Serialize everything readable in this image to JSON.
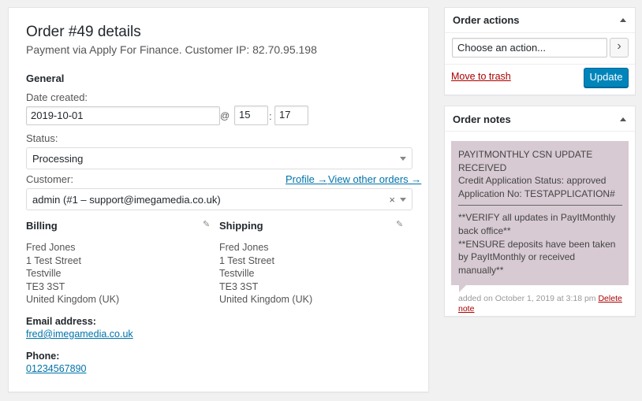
{
  "order": {
    "title": "Order #49 details",
    "subtitle": "Payment via Apply For Finance. Customer IP: 82.70.95.198",
    "general_heading": "General",
    "date_created_label": "Date created:",
    "date_value": "2019-10-01",
    "at_symbol": "@",
    "hour_value": "15",
    "colon": ":",
    "minute_value": "17",
    "status_label": "Status:",
    "status_value": "Processing",
    "customer_label": "Customer:",
    "profile_link": "Profile →",
    "other_orders_link": "View other orders →",
    "customer_value": "admin (#1 – support@imegamedia.co.uk)",
    "clear_symbol": "×",
    "billing": {
      "heading": "Billing",
      "lines": [
        "Fred Jones",
        "1 Test Street",
        "Testville",
        "TE3 3ST",
        "United Kingdom (UK)"
      ],
      "email_label": "Email address:",
      "email_value": "fred@imegamedia.co.uk",
      "phone_label": "Phone:",
      "phone_value": "01234567890"
    },
    "shipping": {
      "heading": "Shipping",
      "lines": [
        "Fred Jones",
        "1 Test Street",
        "Testville",
        "TE3 3ST",
        "United Kingdom (UK)"
      ]
    },
    "edit_icon": "pencil-icon"
  },
  "order_actions": {
    "title": "Order actions",
    "select_value": "Choose an action...",
    "go_symbol": "›",
    "trash_link": "Move to trash",
    "update_button": "Update"
  },
  "order_notes": {
    "title": "Order notes",
    "note_lines": [
      "PAYITMONTHLY CSN UPDATE RECEIVED",
      "Credit Application Status: approved",
      "Application No: TESTAPPLICATION#"
    ],
    "note_lines_2": [
      "**VERIFY all updates in PayItMonthly back office**",
      "**ENSURE deposits have been taken by PayItMonthly or received manually**"
    ],
    "meta": "added on October 1, 2019 at 3:18 pm",
    "delete_link": "Delete note"
  },
  "colors": {
    "accent": "#0073aa",
    "button": "#0085ba",
    "note_bg": "#d7cad2",
    "delete": "#a00000"
  }
}
